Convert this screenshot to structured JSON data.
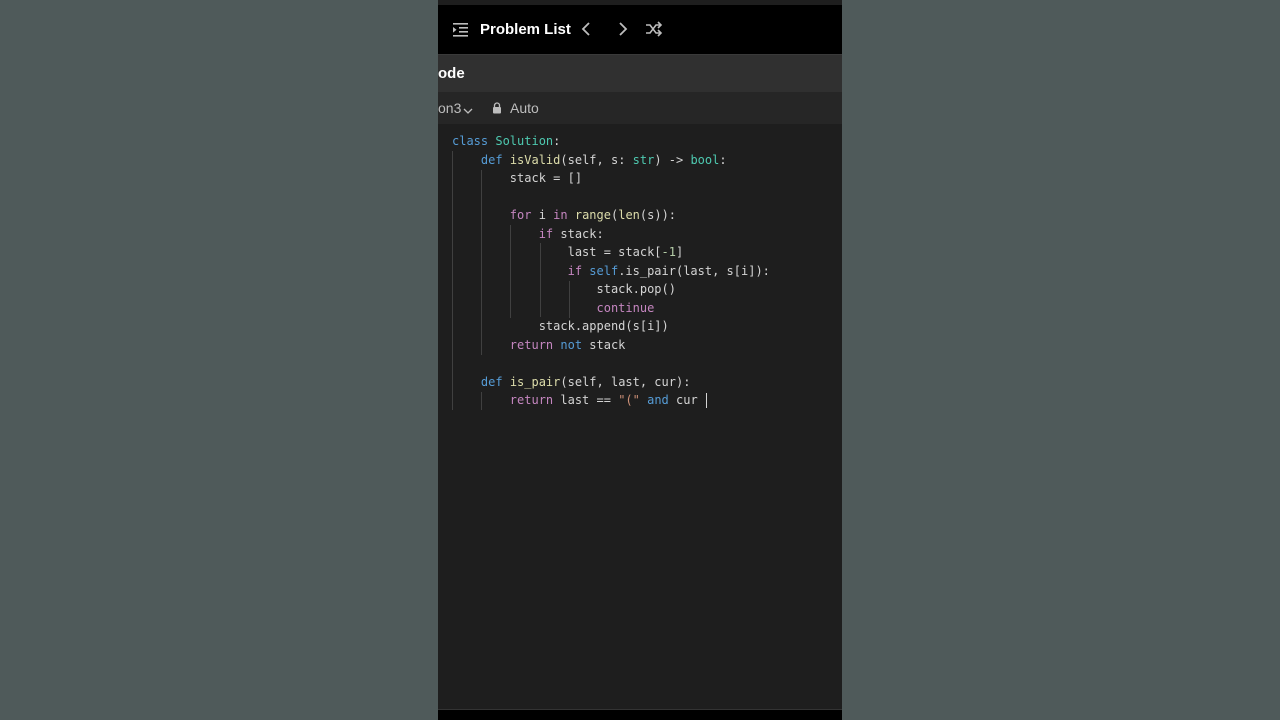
{
  "header": {
    "title": "Problem List",
    "icons": [
      "list-icon",
      "chevron-left-icon",
      "chevron-right-icon",
      "shuffle-icon"
    ]
  },
  "tab": {
    "label": "ode"
  },
  "toolbar": {
    "language": "on3",
    "mode": "Auto"
  },
  "code": {
    "lines": [
      [
        [
          "kwb",
          "class "
        ],
        [
          "cls",
          "Solution"
        ],
        [
          "",
          ":"
        ]
      ],
      [
        [
          "",
          "    "
        ],
        [
          "kwb",
          "def "
        ],
        [
          "fn",
          "isValid"
        ],
        [
          "",
          "(self, s: "
        ],
        [
          "cls",
          "str"
        ],
        [
          "",
          ") -> "
        ],
        [
          "cls",
          "bool"
        ],
        [
          "",
          ":"
        ]
      ],
      [
        [
          "",
          "        stack = []"
        ]
      ],
      [
        [
          "",
          ""
        ]
      ],
      [
        [
          "",
          "        "
        ],
        [
          "kw",
          "for"
        ],
        [
          "",
          " i "
        ],
        [
          "kw",
          "in "
        ],
        [
          "fn",
          "range"
        ],
        [
          "",
          "("
        ],
        [
          "fn",
          "len"
        ],
        [
          "",
          "(s)):"
        ]
      ],
      [
        [
          "",
          "            "
        ],
        [
          "kw",
          "if"
        ],
        [
          "",
          " stack:"
        ]
      ],
      [
        [
          "",
          "                last = stack["
        ],
        [
          "num",
          "-1"
        ],
        [
          "",
          "]"
        ]
      ],
      [
        [
          "",
          "                "
        ],
        [
          "kw",
          "if "
        ],
        [
          "kwb",
          "self"
        ],
        [
          "",
          ".is_pair(last, s[i]):"
        ]
      ],
      [
        [
          "",
          "                    stack.pop()"
        ]
      ],
      [
        [
          "",
          "                    "
        ],
        [
          "kw",
          "continue"
        ]
      ],
      [
        [
          "",
          "            stack.append(s[i])"
        ]
      ],
      [
        [
          "",
          "        "
        ],
        [
          "kw",
          "return "
        ],
        [
          "kwb",
          "not"
        ],
        [
          "",
          " stack"
        ]
      ],
      [
        [
          "",
          ""
        ]
      ],
      [
        [
          "",
          "    "
        ],
        [
          "kwb",
          "def "
        ],
        [
          "fn",
          "is_pair"
        ],
        [
          "",
          "(self, last, cur):"
        ]
      ],
      [
        [
          "",
          "        "
        ],
        [
          "kw",
          "return"
        ],
        [
          "",
          " last == "
        ],
        [
          "str",
          "\"(\""
        ],
        [
          "kwb",
          " and"
        ],
        [
          "",
          " cur "
        ]
      ]
    ]
  },
  "colors": {
    "panel_bg": "#1e1e1e",
    "page_bg": "#4f5a5a",
    "keyword_control": "#c586c0",
    "keyword": "#569cd6",
    "function": "#dcdcaa",
    "class": "#4ec9b0",
    "string": "#ce9178",
    "number": "#b5cea8"
  }
}
